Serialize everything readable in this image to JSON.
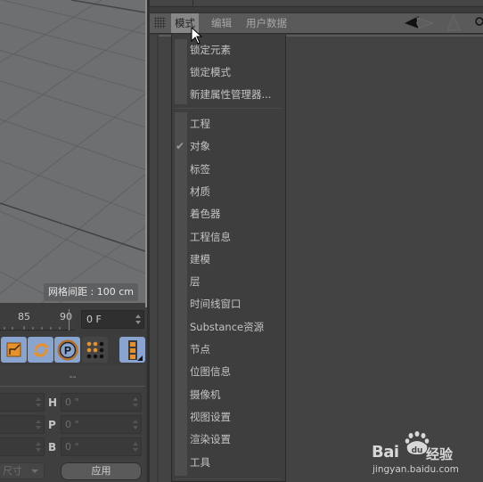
{
  "viewport": {
    "grid_spacing_label": "网格间距 : 100 cm"
  },
  "timeline": {
    "tick_85": "85",
    "tick_90": "90",
    "current_frame": "0 F"
  },
  "toolbar": {
    "icons": [
      "scale-tool-icon",
      "rotate-tool-icon",
      "param-p-icon",
      "keyframe-dots-icon",
      "film-strip-icon"
    ],
    "p_label": "P"
  },
  "attributes": {
    "header_placeholder": "--",
    "rows": [
      {
        "axis": "H",
        "value": "0 °"
      },
      {
        "axis": "P",
        "value": "0 °"
      },
      {
        "axis": "B",
        "value": "0 °"
      }
    ],
    "size_dropdown": "尺寸",
    "apply_label": "应用"
  },
  "manager": {
    "menu": [
      {
        "label": "模式",
        "active": true
      },
      {
        "label": "编辑",
        "active": false
      },
      {
        "label": "用户数据",
        "active": false
      }
    ]
  },
  "mode_menu": {
    "group1": [
      "锁定元素",
      "锁定模式",
      "新建属性管理器..."
    ],
    "group2": [
      {
        "label": "工程",
        "checked": false
      },
      {
        "label": "对象",
        "checked": true
      },
      {
        "label": "标签",
        "checked": false
      },
      {
        "label": "材质",
        "checked": false
      },
      {
        "label": "着色器",
        "checked": false
      },
      {
        "label": "工程信息",
        "checked": false
      },
      {
        "label": "建模",
        "checked": false
      },
      {
        "label": "层",
        "checked": false
      },
      {
        "label": "时间线窗口",
        "checked": false
      },
      {
        "label": "Substance资源",
        "checked": false
      },
      {
        "label": "节点",
        "checked": false
      },
      {
        "label": "位图信息",
        "checked": false
      },
      {
        "label": "摄像机",
        "checked": false
      },
      {
        "label": "视图设置",
        "checked": false
      },
      {
        "label": "渲染设置",
        "checked": false
      },
      {
        "label": "工具",
        "checked": false
      }
    ],
    "check_glyph": "✔"
  },
  "watermark": {
    "brand": "Bai",
    "paw_text": "du",
    "suffix": "经验",
    "url": "jingyan.baidu.com"
  },
  "colors": {
    "accent_button": "#8aa4d0",
    "icon_orange": "#e8902a",
    "active_menu_bg": "#888888"
  }
}
